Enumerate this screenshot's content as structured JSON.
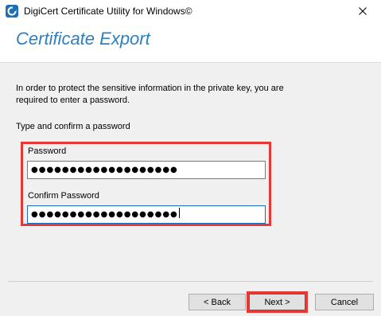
{
  "window": {
    "title": "DigiCert Certificate Utility for Windows©",
    "close_glyph": "✕"
  },
  "header": {
    "title": "Certificate Export"
  },
  "body": {
    "intro": "In order to protect the sensitive information in the private key, you are\nrequired to enter a password.",
    "subhead": "Type and confirm a password"
  },
  "form": {
    "password": {
      "label": "Password",
      "value": "●●●●●●●●●●●●●●●●●●●"
    },
    "confirm": {
      "label": "Confirm Password",
      "value": "●●●●●●●●●●●●●●●●●●●"
    }
  },
  "buttons": {
    "back": "< Back",
    "next": "Next >",
    "cancel": "Cancel"
  },
  "colors": {
    "accent": "#2e7fbf",
    "highlight": "#e53935",
    "focus": "#1a6fc4"
  },
  "icons": {
    "app": "digicert-logo-icon",
    "close": "close-icon"
  }
}
